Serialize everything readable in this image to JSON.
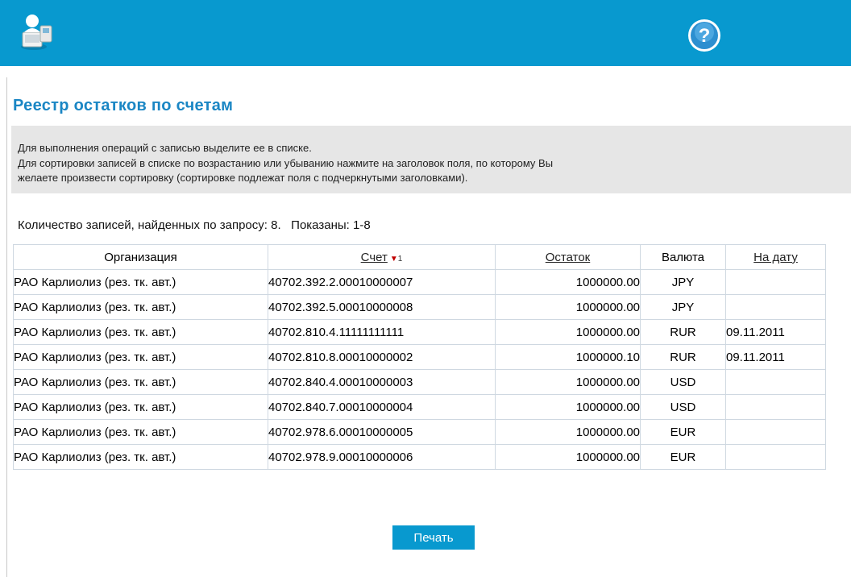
{
  "header": {
    "logo_icon": "user-computer-icon",
    "help_icon": "question-mark-icon",
    "accent_color": "#0899cf"
  },
  "page": {
    "title": "Реестр остатков по счетам"
  },
  "info": {
    "line1": "Для выполнения операций с записью выделите ее в списке.",
    "line2": "Для сортировки записей в списке по возрастанию или убыванию нажмите на заголовок поля, по которому Вы",
    "line3": "желаете произвести сортировку (сортировке подлежат поля с подчеркнутыми заголовками)."
  },
  "summary": {
    "found_label": "Количество  записей, найденных по запросу:",
    "found_count": "8.",
    "shown_label": "Показаны:",
    "shown_range": "1-8"
  },
  "table": {
    "columns": {
      "org": "Организация",
      "account": "Счет",
      "account_sort_num": "1",
      "balance": "Остаток",
      "currency": "Валюта",
      "date": "На дату"
    },
    "rows": [
      {
        "org": "РАО Карлиолиз (рез. тк. авт.)",
        "account": "40702.392.2.00010000007",
        "balance": "1000000.00",
        "currency": "JPY",
        "date": ""
      },
      {
        "org": "РАО Карлиолиз (рез. тк. авт.)",
        "account": "40702.392.5.00010000008",
        "balance": "1000000.00",
        "currency": "JPY",
        "date": ""
      },
      {
        "org": "РАО Карлиолиз (рез. тк. авт.)",
        "account": "40702.810.4.11111111111",
        "balance": "1000000.00",
        "currency": "RUR",
        "date": "09.11.2011"
      },
      {
        "org": "РАО Карлиолиз (рез. тк. авт.)",
        "account": "40702.810.8.00010000002",
        "balance": "1000000.10",
        "currency": "RUR",
        "date": "09.11.2011"
      },
      {
        "org": "РАО Карлиолиз (рез. тк. авт.)",
        "account": "40702.840.4.00010000003",
        "balance": "1000000.00",
        "currency": "USD",
        "date": ""
      },
      {
        "org": "РАО Карлиолиз (рез. тк. авт.)",
        "account": "40702.840.7.00010000004",
        "balance": "1000000.00",
        "currency": "USD",
        "date": ""
      },
      {
        "org": "РАО Карлиолиз (рез. тк. авт.)",
        "account": "40702.978.6.00010000005",
        "balance": "1000000.00",
        "currency": "EUR",
        "date": ""
      },
      {
        "org": "РАО Карлиолиз (рез. тк. авт.)",
        "account": "40702.978.9.00010000006",
        "balance": "1000000.00",
        "currency": "EUR",
        "date": ""
      }
    ]
  },
  "actions": {
    "print_label": "Печать"
  }
}
